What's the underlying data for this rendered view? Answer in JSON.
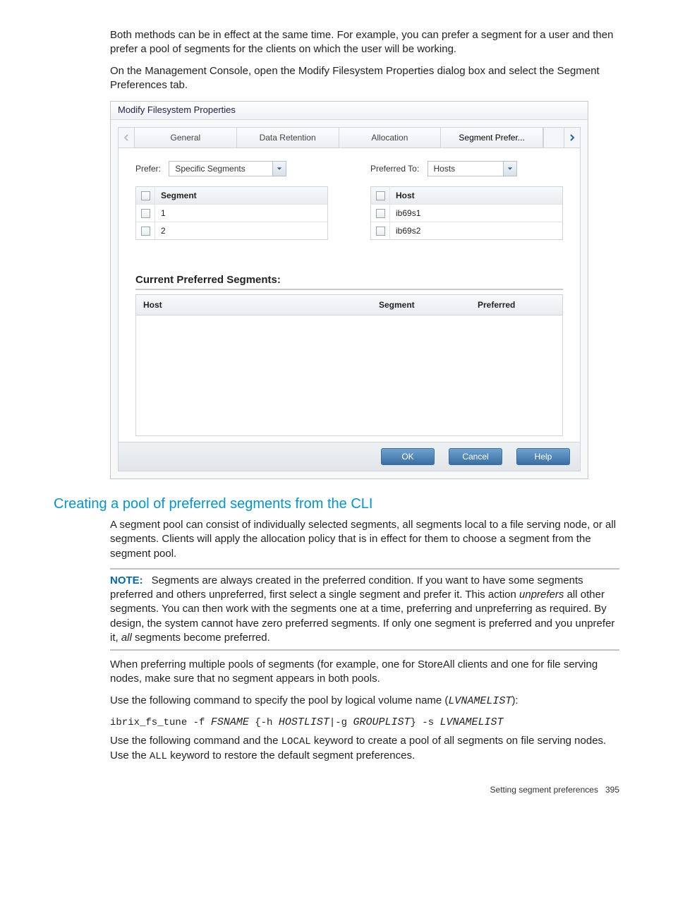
{
  "intro": {
    "p1": "Both methods can be in effect at the same time. For example, you can prefer a segment for a user and then prefer a pool of segments for the clients on which the user will be working.",
    "p2": "On the Management Console, open the Modify Filesystem Properties dialog box and select the Segment Preferences tab."
  },
  "dialog": {
    "title": "Modify Filesystem Properties",
    "tabs": [
      "General",
      "Data Retention",
      "Allocation",
      "Segment Prefer..."
    ],
    "prefer_label": "Prefer:",
    "prefer_value": "Specific Segments",
    "preferred_to_label": "Preferred To:",
    "preferred_to_value": "Hosts",
    "seg_table": {
      "header": "Segment",
      "rows": [
        "1",
        "2"
      ]
    },
    "host_table": {
      "header": "Host",
      "rows": [
        "ib69s1",
        "ib69s2"
      ]
    },
    "section_title": "Current Preferred Segments:",
    "pref_headers": {
      "host": "Host",
      "segment": "Segment",
      "preferred": "Preferred"
    },
    "buttons": {
      "ok": "OK",
      "cancel": "Cancel",
      "help": "Help"
    }
  },
  "section_heading": "Creating a pool of preferred segments from the CLI",
  "section_p1": "A segment pool can consist of individually selected segments, all segments local to a file serving node, or all segments. Clients will apply the allocation policy that is in effect for them to choose a segment from the segment pool.",
  "note": {
    "label": "NOTE:",
    "s1": "Segments are always created in the preferred condition. If you want to have some segments preferred and others unpreferred, first select a single segment and prefer it. This action ",
    "em1": "unprefers",
    "s2": " all other segments. You can then work with the segments one at a time, preferring and unpreferring as required. By design, the system cannot have zero preferred segments. If only one segment is preferred and you unprefer it, ",
    "em2": "all",
    "s3": " segments become preferred."
  },
  "after_note_p": "When preferring multiple pools of segments (for example, one for StoreAll clients and one for file serving nodes, make sure that no segment appears in both pools.",
  "cmd_intro_a": "Use the following command to specify the pool by logical volume name (",
  "cmd_intro_code": "LVNAMELIST",
  "cmd_intro_b": "):",
  "cmd": {
    "t1": "ibrix_fs_tune -f ",
    "v1": "FSNAME",
    "t2": " {-h ",
    "v2": "HOSTLIST",
    "t3": "|-g ",
    "v3": "GROUPLIST",
    "t4": "} -s ",
    "v4": "LVNAMELIST"
  },
  "post_cmd_a": "Use the following command and the ",
  "post_cmd_code1": "LOCAL",
  "post_cmd_b": " keyword to create a pool of all segments on file serving nodes. Use the ",
  "post_cmd_code2": "ALL",
  "post_cmd_c": " keyword to restore the default segment preferences.",
  "footer": {
    "text": "Setting segment preferences",
    "page": "395"
  }
}
